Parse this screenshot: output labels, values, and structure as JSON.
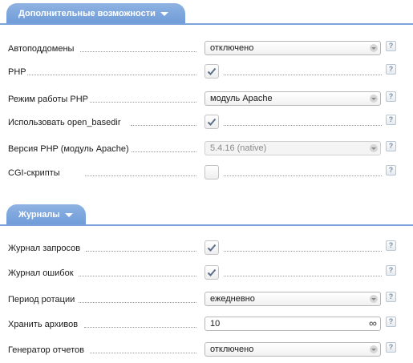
{
  "sections": {
    "advanced": {
      "title": "Дополнительные возможности",
      "rows": {
        "subdomains": {
          "label": "Автоподдомены",
          "value": "отключено"
        },
        "php": {
          "label": "PHP",
          "checked": true
        },
        "php_mode": {
          "label": "Режим работы PHP",
          "value": "модуль Apache"
        },
        "open_basedir": {
          "label": "Использовать open_basedir",
          "checked": true
        },
        "php_version": {
          "label": "Версия PHP (модуль Apache)",
          "value": "5.4.16 (native)",
          "disabled": true
        },
        "cgi": {
          "label": "CGI-скрипты",
          "checked": false
        }
      }
    },
    "logs": {
      "title": "Журналы",
      "rows": {
        "access_log": {
          "label": "Журнал запросов",
          "checked": true
        },
        "error_log": {
          "label": "Журнал ошибок",
          "checked": true
        },
        "rotation": {
          "label": "Период ротации",
          "value": "ежедневно"
        },
        "archives": {
          "label": "Хранить архивов",
          "value": "10",
          "suffix_icon": "infinity-icon"
        },
        "report_gen": {
          "label": "Генератор отчетов",
          "value": "отключено"
        }
      }
    }
  },
  "help_symbol": "?",
  "colors": {
    "accent": "#6f9bd8",
    "check": "#5a6e8a",
    "help": "#7b8da4"
  }
}
